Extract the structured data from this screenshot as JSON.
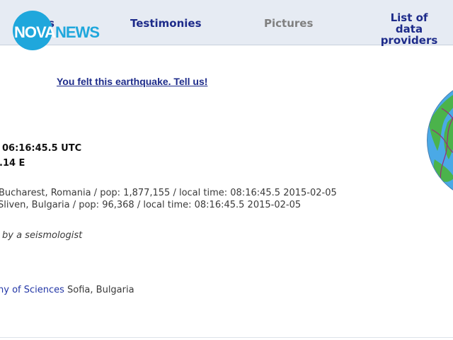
{
  "header": {
    "nav_first_fragment": "s",
    "nav_testimonies": "Testimonies",
    "nav_pictures": "Pictures",
    "nav_providers_line1": "List of data",
    "nav_providers_line2": "providers"
  },
  "logo": {
    "nova": "NOVA",
    "news": "NEWS",
    "colors": {
      "brand_blue": "#1fa7dc",
      "white": "#ffffff"
    }
  },
  "main": {
    "felt_link": "You felt this earthquake. Tell us!",
    "time_fragment": "06:16:45.5 UTC",
    "coord_fragment": ".14 E",
    "city1": "Bucharest, Romania / pop: 1,877,155 / local time: 08:16:45.5 2015-02-05",
    "city2": "Sliven, Bulgaria / pop: 96,368 / local time: 08:16:45.5 2015-02-05",
    "seismologist_fragment": "by a seismologist",
    "academy_link_fragment": "ny of Sciences",
    "academy_location": " Sofia, Bulgaria"
  },
  "map": {
    "icon": "globe-map",
    "colors": {
      "ocean": "#4aa9e6",
      "land": "#4bb34b",
      "plate_boundary": "#9b2a7a"
    }
  },
  "theme": {
    "nav_bg": "#e6ebf3",
    "nav_text": "#1d2b8a",
    "nav_disabled": "#808080",
    "link": "#2236a6"
  }
}
